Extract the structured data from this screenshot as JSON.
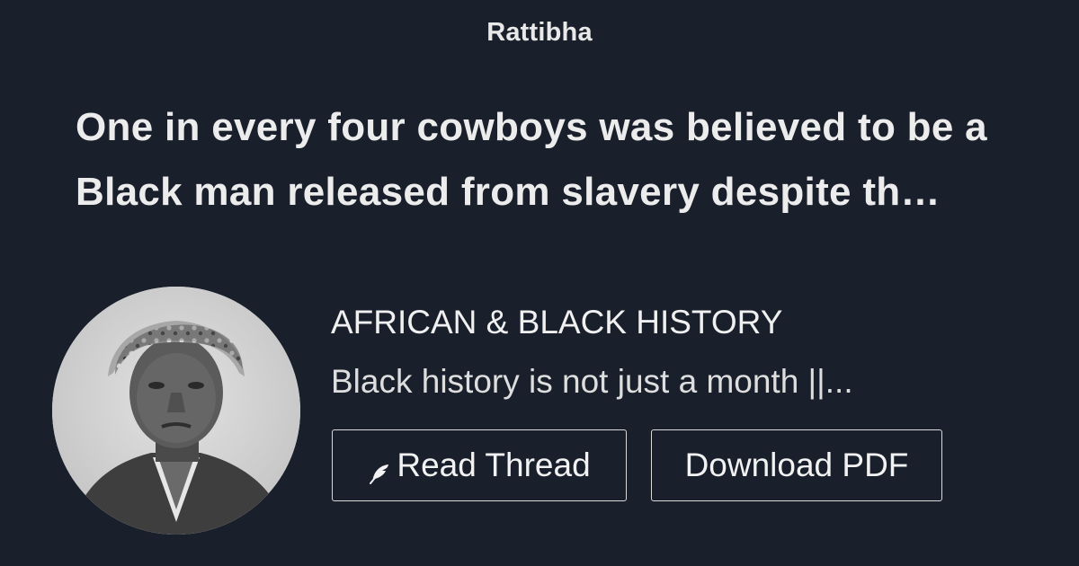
{
  "brand": "Rattibha",
  "thread": {
    "title": "One in every four cowboys was believed to be a Black man released from slavery despite th…"
  },
  "author": {
    "name": "AFRICAN & BLACK HISTORY",
    "bio": "Black history is not just a month ||..."
  },
  "buttons": {
    "read_thread": "Read Thread",
    "download_pdf": "Download PDF"
  },
  "icons": {
    "read_thread_icon": "feather-icon"
  },
  "colors": {
    "background": "#19202c",
    "text": "#ececec",
    "button_border": "#d9d9d9"
  }
}
